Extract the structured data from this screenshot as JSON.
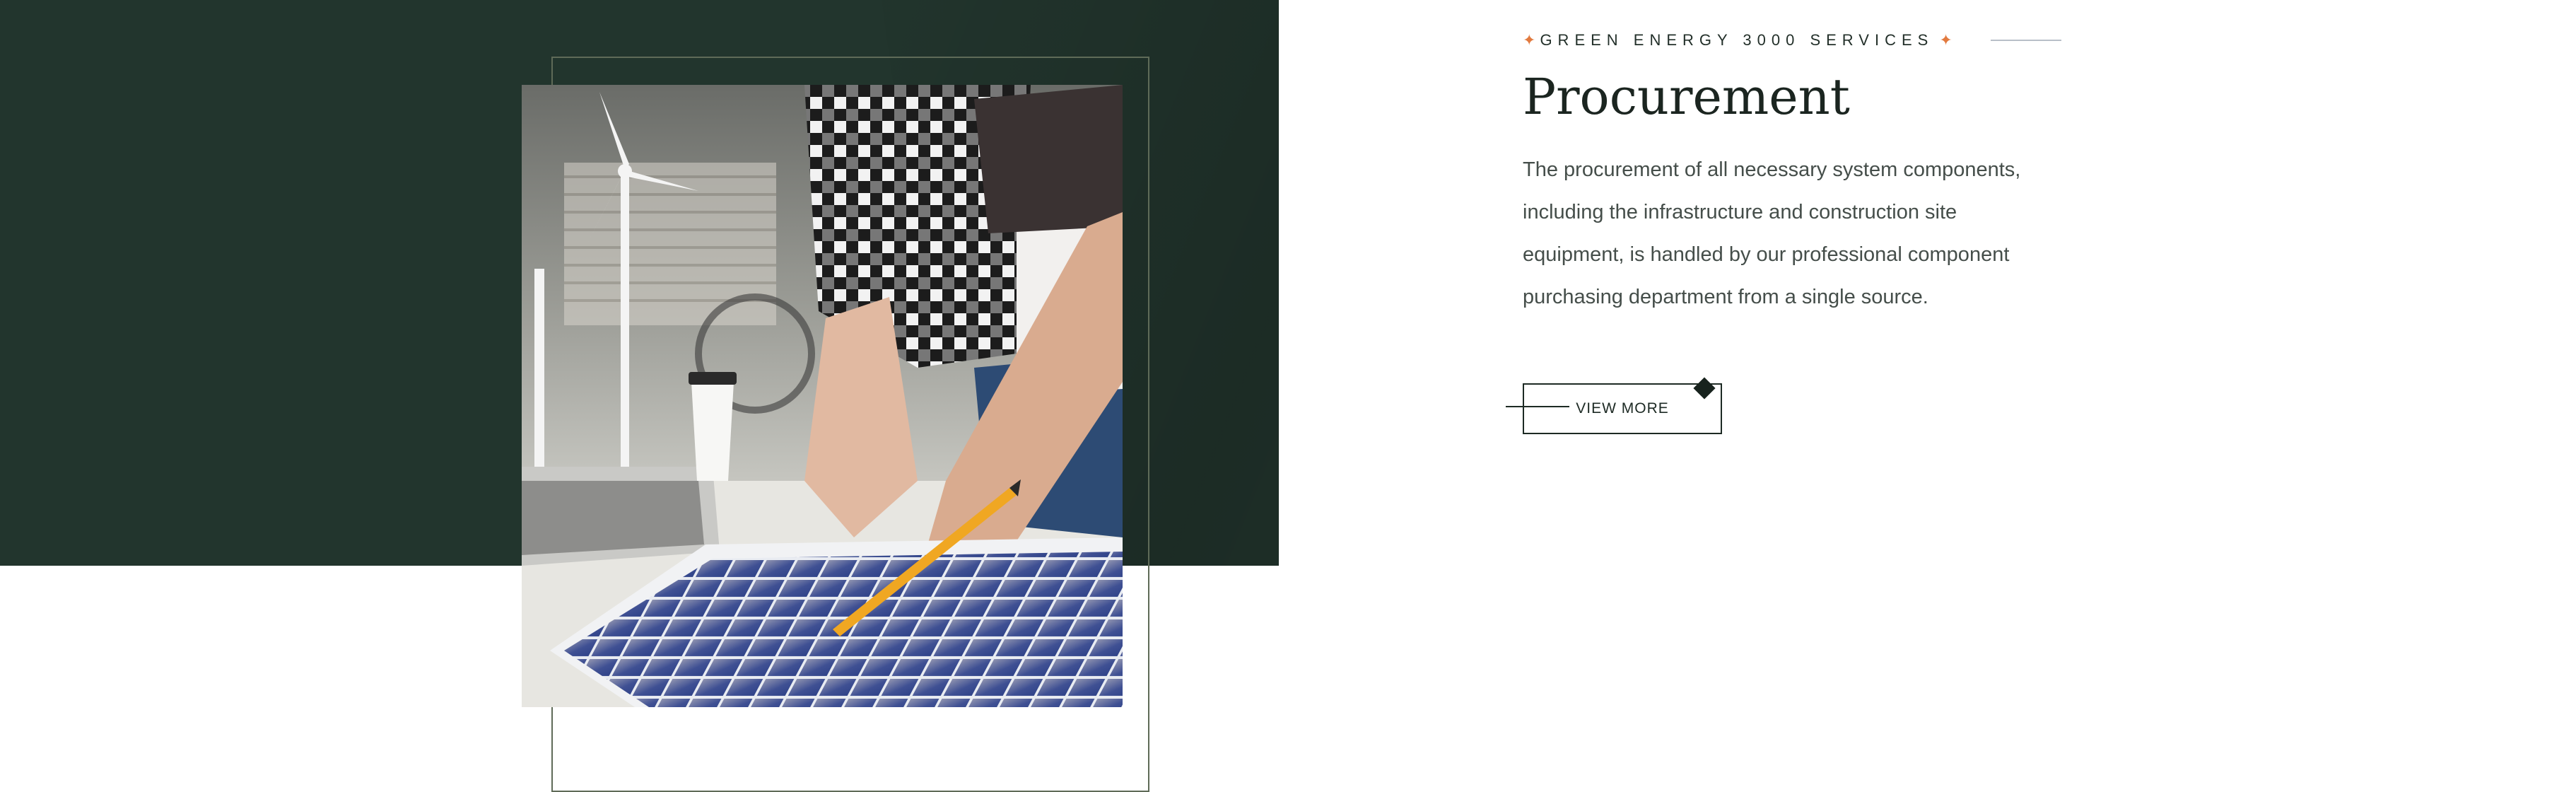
{
  "section": {
    "subtitle": "GREEN ENERGY 3000 SERVICES",
    "title": "Procurement",
    "description": "The procurement of all necessary system components, including the infrastructure and construction site equipment, is handled by our professional component purchasing department from a single source.",
    "button_label": "VIEW MORE"
  },
  "icons": {
    "subtitle_left": "star-icon",
    "subtitle_right": "star-icon",
    "button_decoration": "diamond-icon"
  },
  "colors": {
    "dark_band": "#22352d",
    "accent_star": "#e27a3f",
    "title": "#1b2520",
    "body_text": "#454e4a"
  }
}
